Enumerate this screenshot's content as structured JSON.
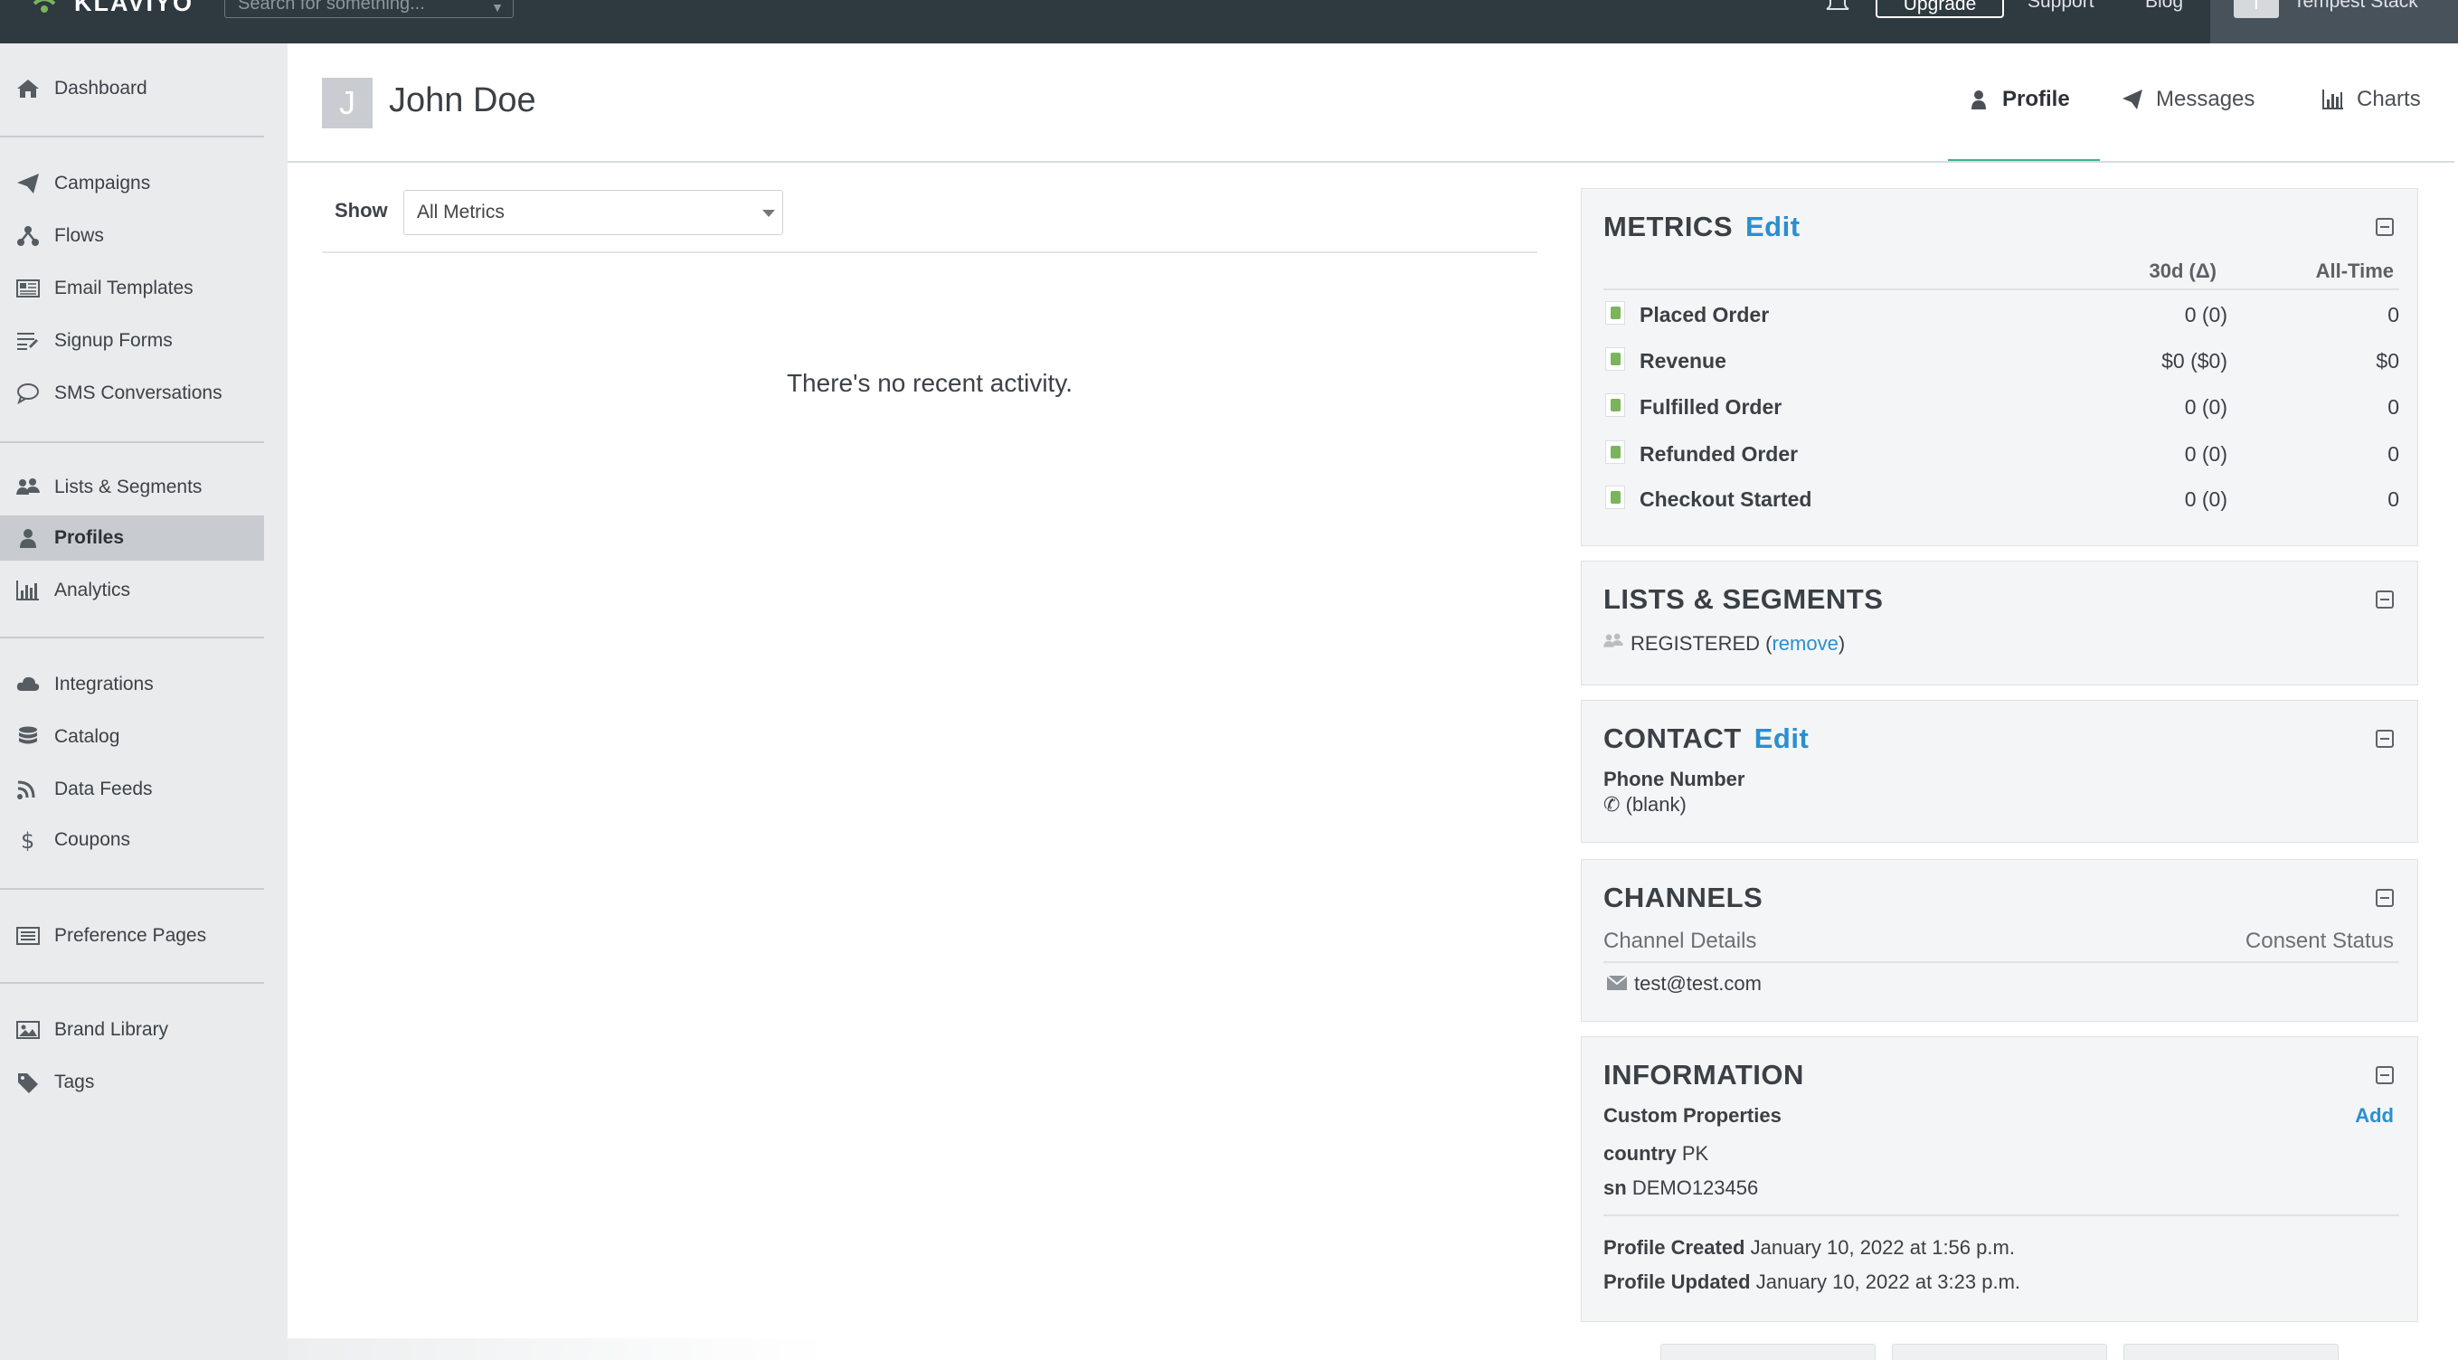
{
  "topbar": {
    "logo": "KLAVIYO",
    "search_placeholder": "Search for something...",
    "upgrade": "Upgrade",
    "support": "Support",
    "blog": "Blog",
    "account_initial": "T",
    "account_name": "Tempest Stack"
  },
  "sidebar": {
    "items": [
      {
        "label": "Dashboard",
        "icon": "home-icon"
      },
      {
        "label": "Campaigns",
        "icon": "paper-plane-icon"
      },
      {
        "label": "Flows",
        "icon": "flow-icon"
      },
      {
        "label": "Email Templates",
        "icon": "template-icon"
      },
      {
        "label": "Signup Forms",
        "icon": "form-icon"
      },
      {
        "label": "SMS Conversations",
        "icon": "chat-icon"
      },
      {
        "label": "Lists & Segments",
        "icon": "users-icon"
      },
      {
        "label": "Profiles",
        "icon": "user-icon"
      },
      {
        "label": "Analytics",
        "icon": "bar-chart-icon"
      },
      {
        "label": "Integrations",
        "icon": "cloud-icon"
      },
      {
        "label": "Catalog",
        "icon": "database-icon"
      },
      {
        "label": "Data Feeds",
        "icon": "rss-icon"
      },
      {
        "label": "Coupons",
        "icon": "dollar-icon"
      },
      {
        "label": "Preference Pages",
        "icon": "list-icon"
      },
      {
        "label": "Brand Library",
        "icon": "image-icon"
      },
      {
        "label": "Tags",
        "icon": "tag-icon"
      }
    ],
    "active": "Profiles"
  },
  "profile": {
    "initial": "J",
    "name": "John Doe"
  },
  "tabs": {
    "profile": "Profile",
    "messages": "Messages",
    "charts": "Charts"
  },
  "activity": {
    "show_label": "Show",
    "metric_selected": "All Metrics",
    "empty_text": "There's no recent activity."
  },
  "metrics": {
    "title": "METRICS",
    "edit": "Edit",
    "col_30d": "30d (Δ)",
    "col_all": "All-Time",
    "rows": [
      {
        "name": "Placed Order",
        "v30": "0 (0)",
        "all": "0"
      },
      {
        "name": "Revenue",
        "v30": "$0 ($0)",
        "all": "$0"
      },
      {
        "name": "Fulfilled Order",
        "v30": "0 (0)",
        "all": "0"
      },
      {
        "name": "Refunded Order",
        "v30": "0 (0)",
        "all": "0"
      },
      {
        "name": "Checkout Started",
        "v30": "0 (0)",
        "all": "0"
      }
    ]
  },
  "lists": {
    "title": "LISTS & SEGMENTS",
    "item": "REGISTERED",
    "open_paren": "(",
    "remove": "remove",
    "close_paren": ")"
  },
  "contact": {
    "title": "CONTACT",
    "edit": "Edit",
    "phone_label": "Phone Number",
    "phone_value": "(blank)"
  },
  "channels": {
    "title": "CHANNELS",
    "col_details": "Channel Details",
    "col_consent": "Consent Status",
    "email": "test@test.com"
  },
  "information": {
    "title": "INFORMATION",
    "custom_label": "Custom Properties",
    "add": "Add",
    "props": [
      {
        "key": "country",
        "value": "PK"
      },
      {
        "key": "sn",
        "value": "DEMO123456"
      }
    ],
    "created_label": "Profile Created",
    "created_value": "January 10, 2022 at 1:56 p.m.",
    "updated_label": "Profile Updated",
    "updated_value": "January 10, 2022 at 3:23 p.m."
  }
}
